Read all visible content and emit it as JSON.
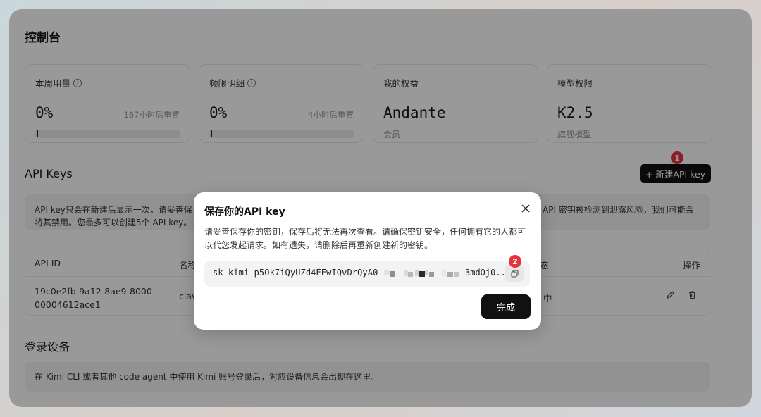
{
  "page": {
    "title": "控制台"
  },
  "cards": [
    {
      "label": "本周用量",
      "value": "0%",
      "reset": "167小时后重置",
      "progress": 0
    },
    {
      "label": "频限明细",
      "value": "0%",
      "reset": "4小时后重置",
      "progress": 0
    },
    {
      "label": "我的权益",
      "value": "Andante",
      "sub": "会员"
    },
    {
      "label": "模型权限",
      "value": "K2.5",
      "sub": "旗舰模型"
    }
  ],
  "api_keys": {
    "title": "API Keys",
    "new_button": "+ 新建API key",
    "notice_left_1": "API key只会在新建后显示一次，请妥善保",
    "notice_left_2": "将其禁用。您最多可以创建5个 API key。",
    "notice_right": "API 密钥被检测到泄露风险，我们可能会",
    "columns": {
      "id": "API ID",
      "name": "名称",
      "status_partial": "态",
      "actions": "操作"
    },
    "rows": [
      {
        "id": "19c0e2fb-9a12-8ae9-8000-00004612ace1",
        "name_partial": "clav",
        "status_partial": "中"
      }
    ]
  },
  "devices": {
    "title": "登录设备",
    "notice": "在 Kimi CLI 或者其他 code agent 中使用 Kimi 账号登录后，对应设备信息会出现在这里。"
  },
  "modal": {
    "title": "保存你的API key",
    "description": "请妥善保存你的密钥，保存后将无法再次查看。请确保密钥安全，任何拥有它的人都可以代您发起请求。如有遗失，请删除后再重新创建新的密钥。",
    "key_start": "sk-kimi-p5Ok7iQyUZd4EEwIQvDrQyA0",
    "key_end": "3mdOj0...",
    "done_button": "完成"
  },
  "annotations": {
    "badge_1": "1",
    "badge_2": "2"
  },
  "colors": {
    "accent_dark": "#111111",
    "badge_red": "#e8313c",
    "overlay": "rgba(0,0,0,0.40)"
  },
  "icons": {
    "info": "info-icon",
    "close": "close-icon",
    "copy": "copy-icon",
    "edit": "pencil-icon",
    "delete": "trash-icon"
  }
}
